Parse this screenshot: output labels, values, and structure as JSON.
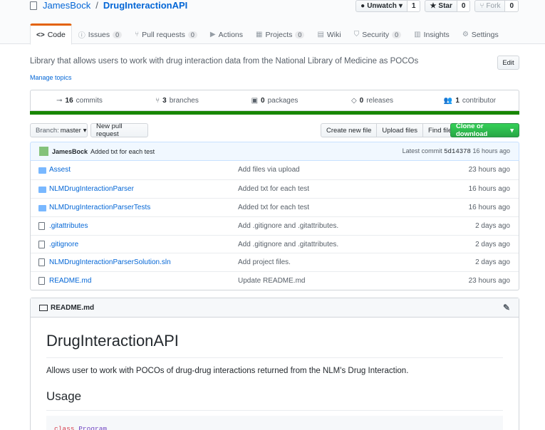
{
  "repo": {
    "owner": "JamesBock",
    "separator": "/",
    "name": "DrugInteractionAPI"
  },
  "actions": {
    "watch_label": "Unwatch",
    "watch_count": "1",
    "star_label": "Star",
    "star_count": "0",
    "fork_label": "Fork",
    "fork_count": "0"
  },
  "tabs": [
    {
      "icon": "code-icon",
      "glyph": "<>",
      "label": "Code",
      "count": null
    },
    {
      "icon": "issue-icon",
      "glyph": "ⓘ",
      "label": "Issues",
      "count": "0"
    },
    {
      "icon": "pull-request-icon",
      "glyph": "⑂",
      "label": "Pull requests",
      "count": "0"
    },
    {
      "icon": "play-icon",
      "glyph": "▶",
      "label": "Actions",
      "count": null
    },
    {
      "icon": "project-icon",
      "glyph": "▦",
      "label": "Projects",
      "count": "0"
    },
    {
      "icon": "book-icon",
      "glyph": "▤",
      "label": "Wiki",
      "count": null
    },
    {
      "icon": "shield-icon",
      "glyph": "⛉",
      "label": "Security",
      "count": "0"
    },
    {
      "icon": "graph-icon",
      "glyph": "▥",
      "label": "Insights",
      "count": null
    },
    {
      "icon": "gear-icon",
      "glyph": "⚙",
      "label": "Settings",
      "count": null
    }
  ],
  "description": "Library that allows users to work with drug interaction data from the National Library of Medicine as POCOs",
  "manage_topics": "Manage topics",
  "edit_label": "Edit",
  "summary": {
    "commits_count": "16",
    "commits_label": "commits",
    "branches_count": "3",
    "branches_label": "branches",
    "packages_count": "0",
    "packages_label": "packages",
    "releases_count": "0",
    "releases_label": "releases",
    "contributors_count": "1",
    "contributors_label": "contributor"
  },
  "colors": {
    "language_bar": "#178600",
    "clone_button": "#28a745",
    "link": "#0366d6"
  },
  "toolbar": {
    "branch_prefix": "Branch:",
    "branch_name": "master",
    "new_pr": "New pull request",
    "create_file": "Create new file",
    "upload_files": "Upload files",
    "find_file": "Find file",
    "clone": "Clone or download"
  },
  "latest_commit": {
    "author": "JamesBock",
    "message": "Added txt for each test",
    "prefix": "Latest commit",
    "sha": "5d14378",
    "age": "16 hours ago"
  },
  "files": [
    {
      "type": "dir",
      "name": "Assest",
      "message": "Add files via upload",
      "age": "23 hours ago"
    },
    {
      "type": "dir",
      "name": "NLMDrugInteractionParser",
      "message": "Added txt for each test",
      "age": "16 hours ago"
    },
    {
      "type": "dir",
      "name": "NLMDrugInteractionParserTests",
      "message": "Added txt for each test",
      "age": "16 hours ago"
    },
    {
      "type": "file",
      "name": ".gitattributes",
      "message": "Add .gitignore and .gitattributes.",
      "age": "2 days ago"
    },
    {
      "type": "file",
      "name": ".gitignore",
      "message": "Add .gitignore and .gitattributes.",
      "age": "2 days ago"
    },
    {
      "type": "file",
      "name": "NLMDrugInteractionParserSolution.sln",
      "message": "Add project files.",
      "age": "2 days ago"
    },
    {
      "type": "file",
      "name": "README.md",
      "message": "Update README.md",
      "age": "23 hours ago"
    }
  ],
  "readme": {
    "header": "README.md",
    "h1": "DrugInteractionAPI",
    "paragraph": "Allows user to work with POCOs of drug-drug interactions returned from the NLM's Drug Interaction.",
    "h2": "Usage",
    "code_keyword": "class",
    "code_class": "Program"
  }
}
